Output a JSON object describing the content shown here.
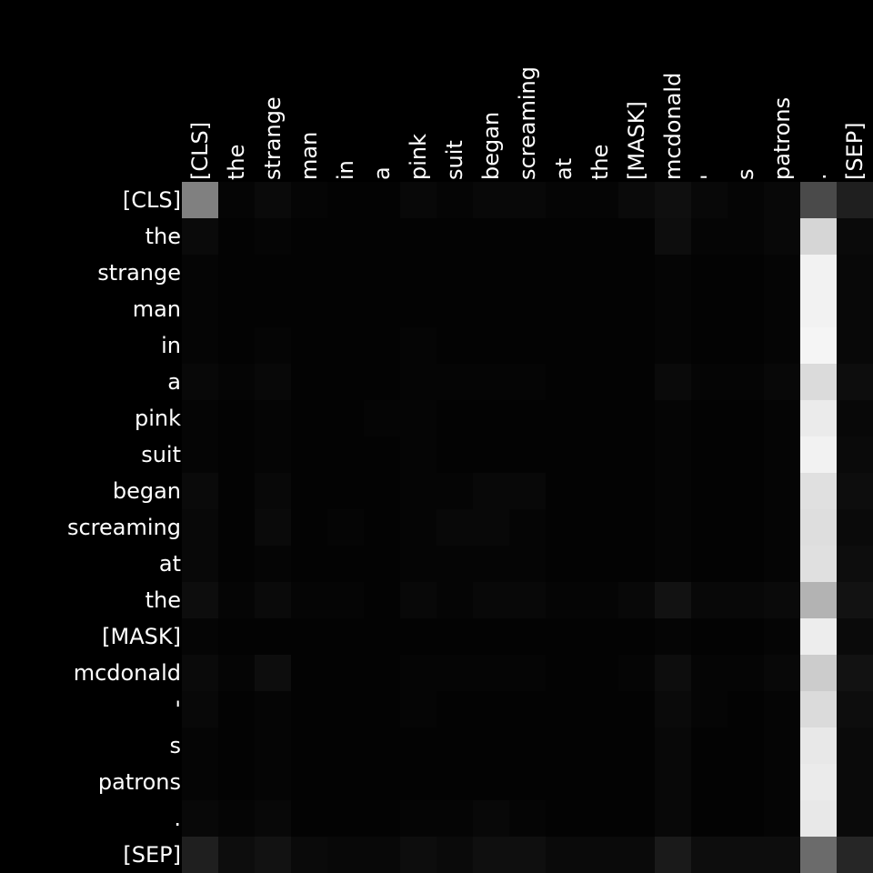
{
  "chart_data": {
    "type": "heatmap",
    "colormap": "grayscale",
    "x_tokens": [
      "[CLS]",
      "the",
      "strange",
      "man",
      "in",
      "a",
      "pink",
      "suit",
      "began",
      "screaming",
      "at",
      "the",
      "[MASK]",
      "mcdonald",
      "'",
      "s",
      "patrons",
      ".",
      "[SEP]"
    ],
    "y_tokens": [
      "[CLS]",
      "the",
      "strange",
      "man",
      "in",
      "a",
      "pink",
      "suit",
      "began",
      "screaming",
      "at",
      "the",
      "[MASK]",
      "mcdonald",
      "'",
      "s",
      "patrons",
      ".",
      "[SEP]"
    ],
    "values": [
      [
        0.5,
        0.02,
        0.04,
        0.02,
        0.01,
        0.01,
        0.03,
        0.02,
        0.03,
        0.03,
        0.02,
        0.02,
        0.04,
        0.06,
        0.03,
        0.02,
        0.03,
        0.29,
        0.12
      ],
      [
        0.04,
        0.01,
        0.02,
        0.01,
        0.01,
        0.01,
        0.01,
        0.01,
        0.01,
        0.01,
        0.01,
        0.01,
        0.01,
        0.05,
        0.02,
        0.02,
        0.03,
        0.84,
        0.04
      ],
      [
        0.02,
        0.01,
        0.01,
        0.01,
        0.01,
        0.01,
        0.01,
        0.01,
        0.01,
        0.01,
        0.01,
        0.01,
        0.01,
        0.02,
        0.01,
        0.01,
        0.02,
        0.95,
        0.03
      ],
      [
        0.02,
        0.01,
        0.01,
        0.01,
        0.01,
        0.01,
        0.01,
        0.01,
        0.01,
        0.01,
        0.01,
        0.01,
        0.01,
        0.02,
        0.01,
        0.01,
        0.02,
        0.95,
        0.03
      ],
      [
        0.02,
        0.01,
        0.02,
        0.01,
        0.01,
        0.01,
        0.02,
        0.01,
        0.01,
        0.01,
        0.01,
        0.01,
        0.01,
        0.02,
        0.01,
        0.01,
        0.02,
        0.96,
        0.03
      ],
      [
        0.03,
        0.02,
        0.03,
        0.01,
        0.01,
        0.01,
        0.02,
        0.02,
        0.02,
        0.02,
        0.01,
        0.01,
        0.01,
        0.04,
        0.02,
        0.02,
        0.03,
        0.86,
        0.05
      ],
      [
        0.02,
        0.01,
        0.02,
        0.01,
        0.01,
        0.02,
        0.02,
        0.01,
        0.01,
        0.01,
        0.01,
        0.01,
        0.01,
        0.02,
        0.01,
        0.01,
        0.02,
        0.92,
        0.03
      ],
      [
        0.02,
        0.01,
        0.02,
        0.01,
        0.01,
        0.01,
        0.02,
        0.01,
        0.01,
        0.01,
        0.01,
        0.01,
        0.01,
        0.02,
        0.01,
        0.01,
        0.02,
        0.95,
        0.04
      ],
      [
        0.04,
        0.01,
        0.03,
        0.01,
        0.01,
        0.01,
        0.02,
        0.02,
        0.03,
        0.03,
        0.01,
        0.01,
        0.01,
        0.02,
        0.01,
        0.01,
        0.02,
        0.88,
        0.05
      ],
      [
        0.03,
        0.01,
        0.04,
        0.01,
        0.02,
        0.01,
        0.02,
        0.03,
        0.03,
        0.02,
        0.01,
        0.01,
        0.01,
        0.02,
        0.01,
        0.01,
        0.02,
        0.87,
        0.04
      ],
      [
        0.03,
        0.01,
        0.02,
        0.01,
        0.01,
        0.01,
        0.02,
        0.02,
        0.02,
        0.02,
        0.01,
        0.01,
        0.01,
        0.02,
        0.01,
        0.01,
        0.02,
        0.88,
        0.05
      ],
      [
        0.05,
        0.02,
        0.04,
        0.02,
        0.02,
        0.01,
        0.03,
        0.02,
        0.03,
        0.03,
        0.02,
        0.02,
        0.03,
        0.07,
        0.03,
        0.03,
        0.04,
        0.7,
        0.07
      ],
      [
        0.02,
        0.01,
        0.01,
        0.01,
        0.01,
        0.01,
        0.01,
        0.01,
        0.01,
        0.01,
        0.01,
        0.01,
        0.01,
        0.02,
        0.01,
        0.01,
        0.02,
        0.93,
        0.04
      ],
      [
        0.04,
        0.02,
        0.05,
        0.01,
        0.01,
        0.01,
        0.02,
        0.02,
        0.02,
        0.02,
        0.01,
        0.01,
        0.02,
        0.05,
        0.02,
        0.02,
        0.03,
        0.8,
        0.07
      ],
      [
        0.03,
        0.01,
        0.02,
        0.01,
        0.01,
        0.01,
        0.02,
        0.01,
        0.01,
        0.01,
        0.01,
        0.01,
        0.01,
        0.04,
        0.02,
        0.01,
        0.02,
        0.86,
        0.05
      ],
      [
        0.02,
        0.01,
        0.02,
        0.01,
        0.01,
        0.01,
        0.01,
        0.01,
        0.01,
        0.01,
        0.01,
        0.01,
        0.01,
        0.03,
        0.01,
        0.01,
        0.02,
        0.91,
        0.04
      ],
      [
        0.02,
        0.01,
        0.02,
        0.01,
        0.01,
        0.01,
        0.01,
        0.01,
        0.01,
        0.01,
        0.01,
        0.01,
        0.01,
        0.03,
        0.01,
        0.01,
        0.02,
        0.92,
        0.04
      ],
      [
        0.03,
        0.02,
        0.03,
        0.01,
        0.01,
        0.01,
        0.02,
        0.02,
        0.03,
        0.02,
        0.01,
        0.01,
        0.01,
        0.03,
        0.01,
        0.01,
        0.02,
        0.91,
        0.04
      ],
      [
        0.12,
        0.05,
        0.07,
        0.04,
        0.03,
        0.03,
        0.05,
        0.04,
        0.06,
        0.06,
        0.04,
        0.04,
        0.04,
        0.1,
        0.05,
        0.05,
        0.05,
        0.42,
        0.15
      ]
    ]
  }
}
